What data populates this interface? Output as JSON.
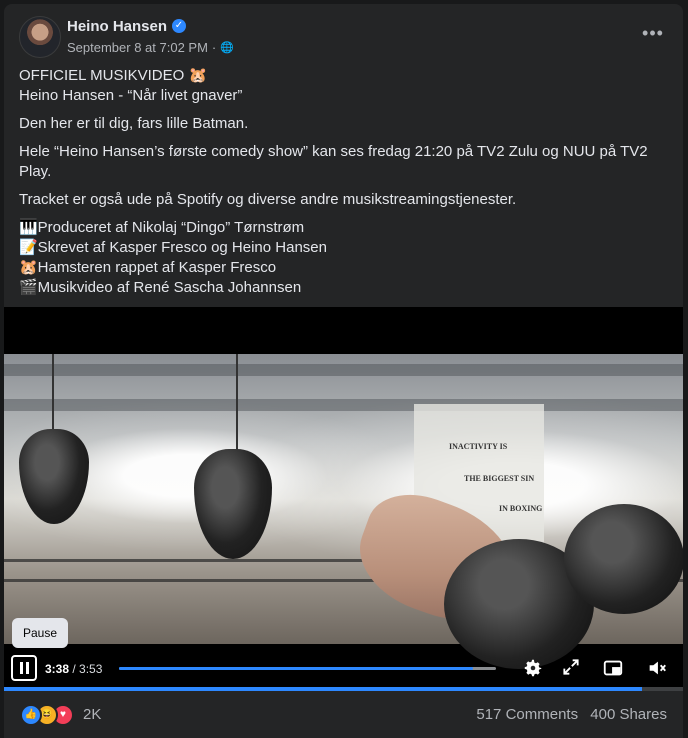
{
  "post": {
    "author": "Heino Hansen",
    "timestamp": "September 8 at 7:02 PM",
    "more_label": "•••",
    "lines": [
      "OFFICIEL MUSIKVIDEO 🐹",
      "Heino Hansen - “Når livet gnaver”"
    ],
    "paragraph_1": "Den her er til dig, fars lille Batman.",
    "paragraph_2": "Hele “Heino Hansen’s første comedy show” kan ses fredag 21:20 på TV2 Zulu og NUU på TV2 Play.",
    "paragraph_3": "Tracket er også ude på Spotify og diverse andre musikstreamingstjenester.",
    "credits": [
      "🎹Produceret af Nikolaj “Dingo” Tørnstrøm",
      "📝Skrevet af Kasper Fresco og Heino Hansen",
      "🐹Hamsteren rappet af Kasper Fresco",
      "🎬Musikvideo af René Sascha Johannsen"
    ]
  },
  "video": {
    "tooltip": "Pause",
    "current_time": "3:38",
    "separator": " / ",
    "duration": "3:53",
    "progress": 0.94,
    "wall_text": [
      "INACTIVITY IS",
      "THE BIGGEST SIN",
      "IN BOXING"
    ]
  },
  "footer": {
    "reaction_count": "2K",
    "comments": "517 Comments",
    "shares": "400 Shares"
  },
  "colors": {
    "accent": "#2d88ff",
    "card": "#242526",
    "background": "#18191a"
  }
}
